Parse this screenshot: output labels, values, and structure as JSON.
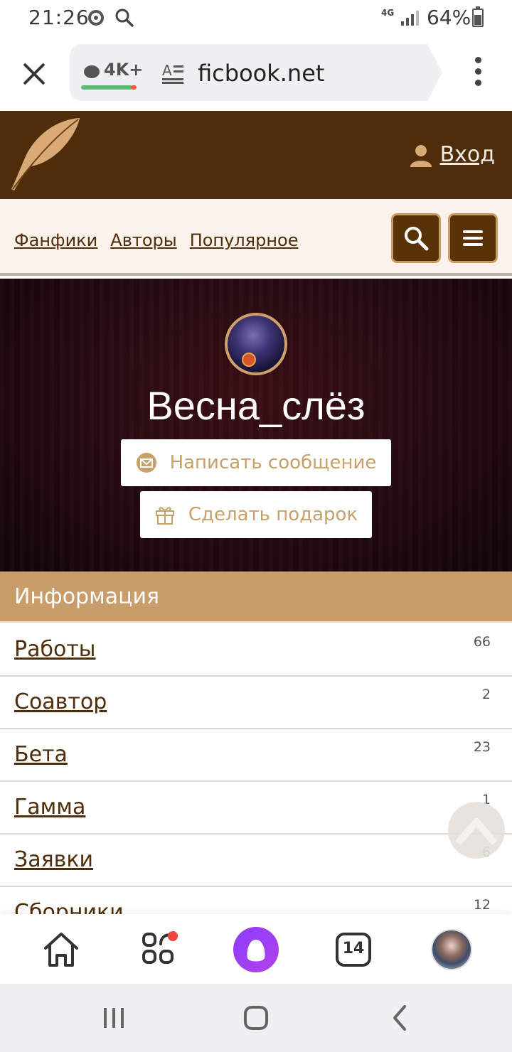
{
  "status_bar": {
    "time": "21:26",
    "network": "4G",
    "battery": "64%"
  },
  "browser": {
    "comments_count": "4K+",
    "domain": "ficbook.net"
  },
  "site_header": {
    "login_label": "Вход"
  },
  "nav": {
    "links": [
      "Фанфики",
      "Авторы",
      "Популярное"
    ]
  },
  "profile": {
    "username": "Весна_слёз",
    "message_button": "Написать сообщение",
    "gift_button": "Сделать подарок"
  },
  "info": {
    "title": "Информация",
    "rows": [
      {
        "label": "Работы",
        "count": "66"
      },
      {
        "label": "Соавтор",
        "count": "2"
      },
      {
        "label": "Бета",
        "count": "23"
      },
      {
        "label": "Гамма",
        "count": "1"
      },
      {
        "label": "Заявки",
        "count": "6"
      },
      {
        "label": "Сборники",
        "count": "12"
      }
    ]
  },
  "bottom_nav": {
    "tabs_count": "14"
  },
  "colors": {
    "header_brown": "#4f2d0a",
    "accent_tan": "#c89d6a",
    "nav_bg": "#fbf3eb"
  }
}
